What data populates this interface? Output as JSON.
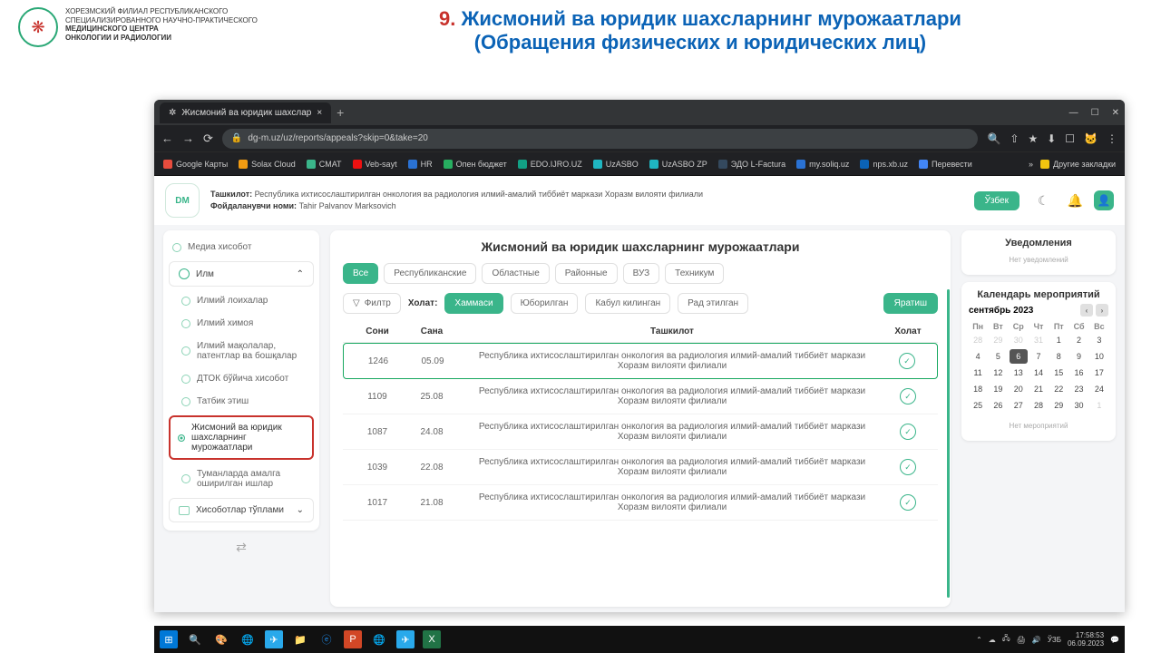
{
  "slide": {
    "num": "9.",
    "title_uz": "Жисмоний ва юридик шахсларнинг мурожаатлари",
    "title_ru": "(Обращения физических и юридических лиц)",
    "org1": "ХОРЕЗМСКИЙ ФИЛИАЛ РЕСПУБЛИКАНСКОГО",
    "org2": "СПЕЦИАЛИЗИРОВАННОГО НАУЧНО-ПРАКТИЧЕСКОГО",
    "org3": "МЕДИЦИНСКОГО ЦЕНТРА",
    "org4": "ОНКОЛОГИИ И РАДИОЛОГИИ"
  },
  "browser": {
    "tab_title": "Жисмоний ва юридик шахслар",
    "url": "dg-m.uz/uz/reports/appeals?skip=0&take=20",
    "bookmarks": [
      "Google Карты",
      "Solax Cloud",
      "CMAT",
      "Veb-sayt",
      "HR",
      "Опен бюджет",
      "EDO.IJRO.UZ",
      "UzASBO",
      "UzASBO ZP",
      "ЭДО L-Factura",
      "my.soliq.uz",
      "nps.xb.uz",
      "Перевести"
    ],
    "other_bm": "Другие закладки"
  },
  "header": {
    "org_label": "Ташкилот:",
    "org_value": "Республика ихтисослаштирилган онкология ва радиология илмий-амалий тиббиёт маркази Хоразм вилояти филиали",
    "user_label": "Фойдаланувчи номи:",
    "user_value": "Tahir Palvanov Marksovich",
    "lang": "Ўзбек"
  },
  "sidebar": {
    "item_top": "Медиа хисобот",
    "group1": "Илм",
    "sub1": "Илмий лоихалар",
    "sub2": "Илмий химоя",
    "sub3": "Илмий мақолалар, патентлар ва бошқалар",
    "sub4": "ДТОК бўйича хисобот",
    "sub5": "Татбик этиш",
    "active": "Жисмоний ва юридик шахсларнинг мурожаатлари",
    "sub6": "Туманларда амалга оширилган ишлар",
    "group2": "Хисоботлар тўплами"
  },
  "main": {
    "title": "Жисмоний ва юридик шахсларнинг мурожаатлари",
    "scope": [
      "Все",
      "Республиканские",
      "Областные",
      "Районные",
      "ВУЗ",
      "Техникум"
    ],
    "filter_btn": "Филтр",
    "status_label": "Холат:",
    "statuses": [
      "Хаммаси",
      "Юборилган",
      "Кабул килинган",
      "Рад этилган"
    ],
    "create": "Яратиш",
    "cols": {
      "soni": "Сони",
      "sana": "Сана",
      "org": "Ташкилот",
      "stat": "Холат"
    },
    "org_row": "Республика ихтисослаштирилган онкология ва радиология илмий-амалий тиббиёт маркази Хоразм вилояти филиали",
    "rows": [
      {
        "n": "1246",
        "d": "05.09"
      },
      {
        "n": "1109",
        "d": "25.08"
      },
      {
        "n": "1087",
        "d": "24.08"
      },
      {
        "n": "1039",
        "d": "22.08"
      },
      {
        "n": "1017",
        "d": "21.08"
      }
    ]
  },
  "rail": {
    "notif_title": "Уведомления",
    "notif_empty": "Нет уведомлений",
    "cal_title": "Календарь мероприятий",
    "month": "сентябрь 2023",
    "days": [
      "Пн",
      "Вт",
      "Ср",
      "Чт",
      "Пт",
      "Сб",
      "Вс"
    ],
    "cal_empty": "Нет мероприятий"
  },
  "taskbar": {
    "lang": "ЎЗБ",
    "time": "17:58:53",
    "date": "06.09.2023"
  }
}
